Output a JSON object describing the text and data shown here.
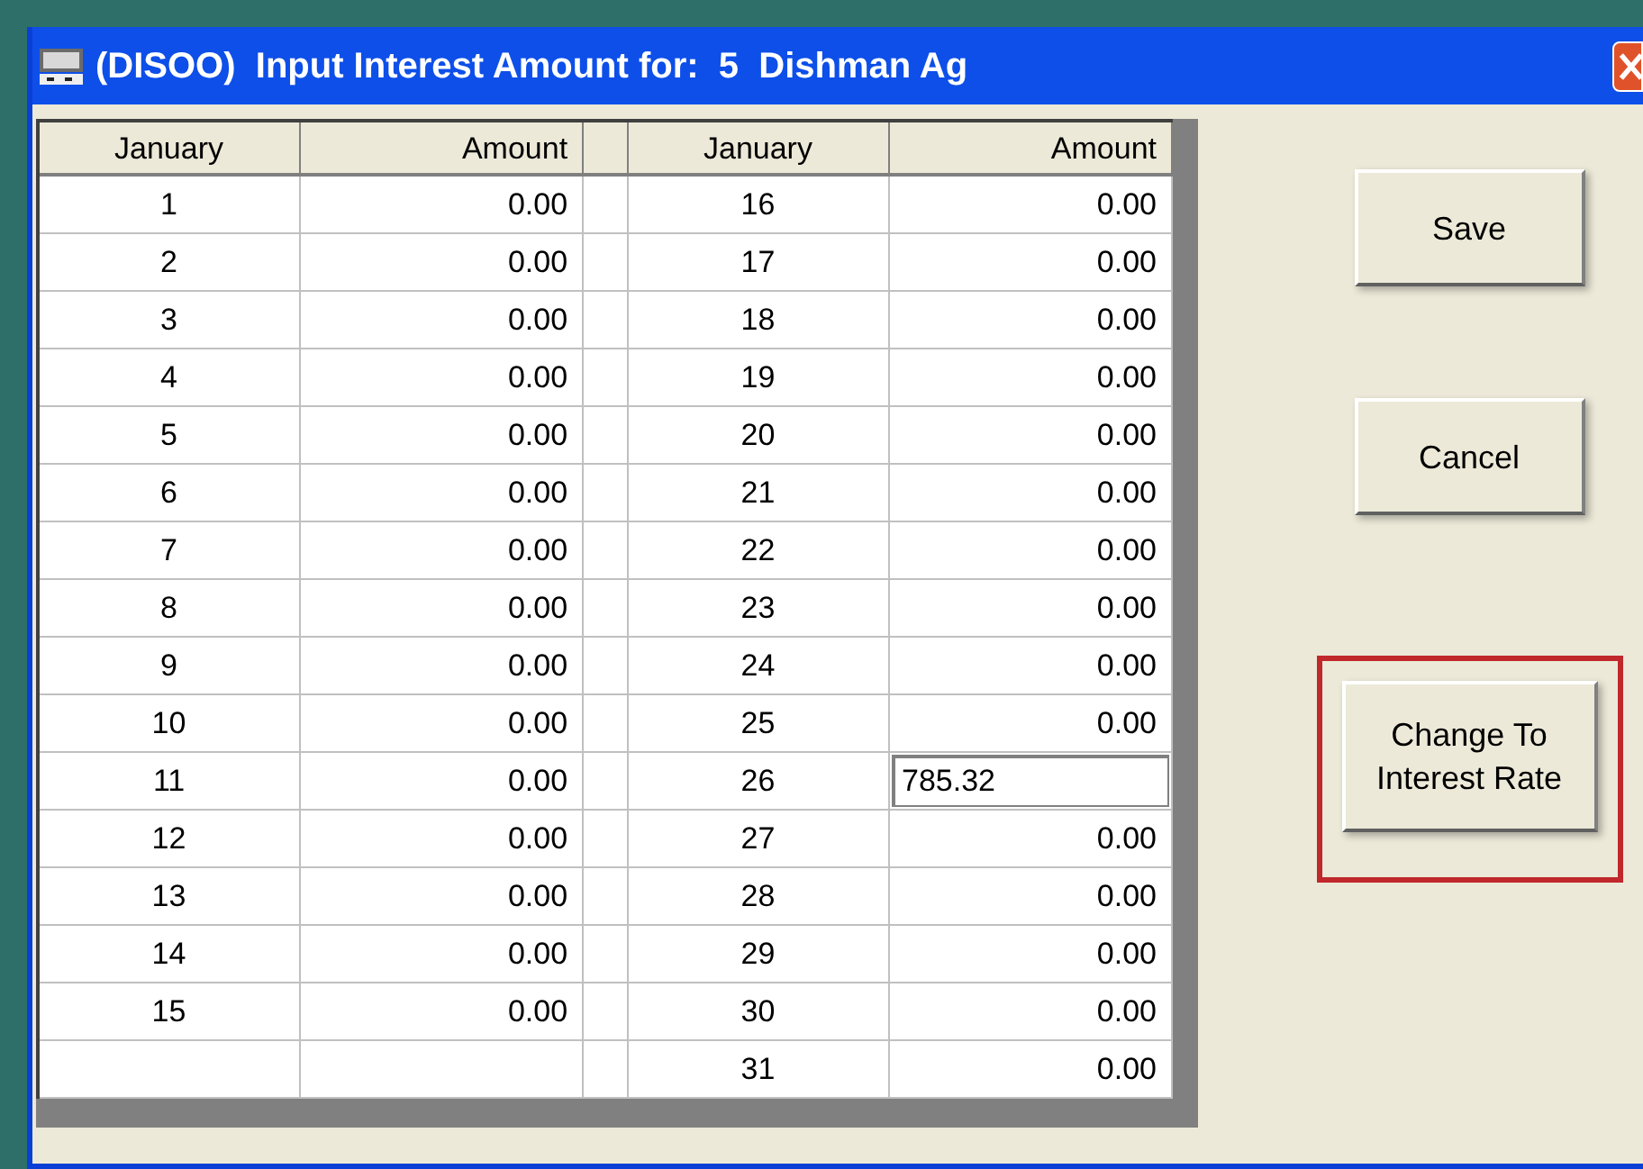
{
  "window": {
    "title": "(DISOO)  Input Interest Amount for:  5  Dishman Ag"
  },
  "table": {
    "columns": [
      "January",
      "Amount",
      "January",
      "Amount"
    ],
    "rows": [
      {
        "day_a": "1",
        "amount_a": "0.00",
        "day_b": "16",
        "amount_b": "0.00",
        "editing": false
      },
      {
        "day_a": "2",
        "amount_a": "0.00",
        "day_b": "17",
        "amount_b": "0.00",
        "editing": false
      },
      {
        "day_a": "3",
        "amount_a": "0.00",
        "day_b": "18",
        "amount_b": "0.00",
        "editing": false
      },
      {
        "day_a": "4",
        "amount_a": "0.00",
        "day_b": "19",
        "amount_b": "0.00",
        "editing": false
      },
      {
        "day_a": "5",
        "amount_a": "0.00",
        "day_b": "20",
        "amount_b": "0.00",
        "editing": false
      },
      {
        "day_a": "6",
        "amount_a": "0.00",
        "day_b": "21",
        "amount_b": "0.00",
        "editing": false
      },
      {
        "day_a": "7",
        "amount_a": "0.00",
        "day_b": "22",
        "amount_b": "0.00",
        "editing": false
      },
      {
        "day_a": "8",
        "amount_a": "0.00",
        "day_b": "23",
        "amount_b": "0.00",
        "editing": false
      },
      {
        "day_a": "9",
        "amount_a": "0.00",
        "day_b": "24",
        "amount_b": "0.00",
        "editing": false
      },
      {
        "day_a": "10",
        "amount_a": "0.00",
        "day_b": "25",
        "amount_b": "0.00",
        "editing": false
      },
      {
        "day_a": "11",
        "amount_a": "0.00",
        "day_b": "26",
        "amount_b": "785.32",
        "editing": true
      },
      {
        "day_a": "12",
        "amount_a": "0.00",
        "day_b": "27",
        "amount_b": "0.00",
        "editing": false
      },
      {
        "day_a": "13",
        "amount_a": "0.00",
        "day_b": "28",
        "amount_b": "0.00",
        "editing": false
      },
      {
        "day_a": "14",
        "amount_a": "0.00",
        "day_b": "29",
        "amount_b": "0.00",
        "editing": false
      },
      {
        "day_a": "15",
        "amount_a": "0.00",
        "day_b": "30",
        "amount_b": "0.00",
        "editing": false
      },
      {
        "day_b": "31",
        "amount_b": "0.00",
        "editing": false
      }
    ]
  },
  "buttons": [
    {
      "label": "Save",
      "highlighted": false
    },
    {
      "label": "Cancel",
      "highlighted": false
    },
    {
      "label": "Change To\nInterest Rate",
      "highlighted": true
    }
  ]
}
